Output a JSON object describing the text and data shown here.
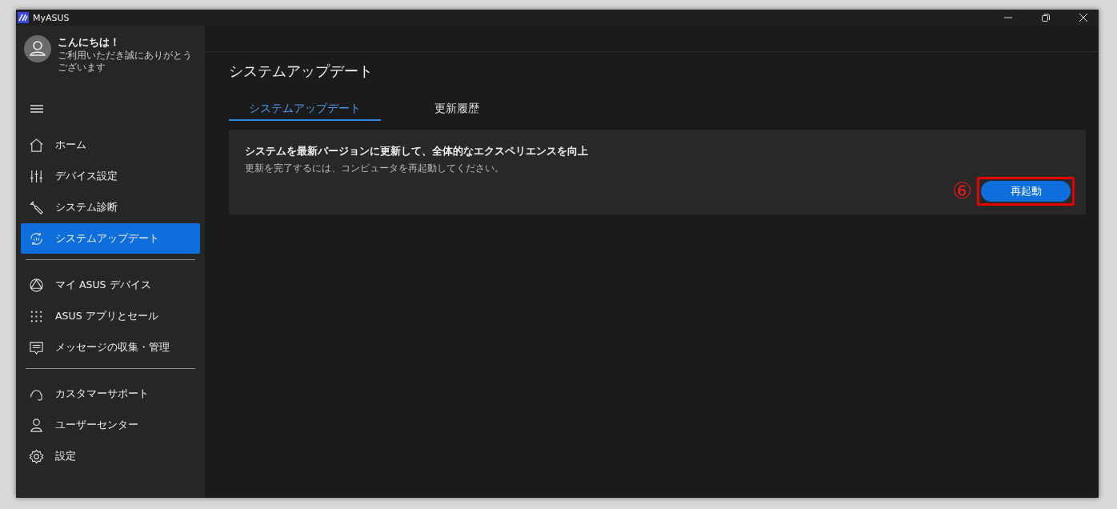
{
  "window": {
    "title": "MyASUS"
  },
  "user": {
    "greeting": "こんにちは！",
    "message": "ご利用いただき誠にありがとうございます"
  },
  "sidebar": {
    "groups": [
      [
        {
          "label": "ホーム",
          "selected": false
        },
        {
          "label": "デバイス設定",
          "selected": false
        },
        {
          "label": "システム診断",
          "selected": false
        },
        {
          "label": "システムアップデート",
          "selected": true
        }
      ],
      [
        {
          "label": "マイ ASUS デバイス",
          "selected": false
        },
        {
          "label": "ASUS アプリとセール",
          "selected": false
        },
        {
          "label": "メッセージの収集・管理",
          "selected": false
        }
      ],
      [
        {
          "label": "カスタマーサポート",
          "selected": false
        },
        {
          "label": "ユーザーセンター",
          "selected": false
        },
        {
          "label": "設定",
          "selected": false
        }
      ]
    ]
  },
  "page": {
    "title": "システムアップデート",
    "tabs": [
      {
        "label": "システムアップデート",
        "selected": true
      },
      {
        "label": "更新履歴",
        "selected": false
      }
    ],
    "card": {
      "heading": "システムを最新バージョンに更新して、全体的なエクスペリエンスを向上",
      "note": "更新を完了するには、コンピュータを再起動してください。",
      "button": "再起動",
      "annotation": "⑥"
    }
  }
}
